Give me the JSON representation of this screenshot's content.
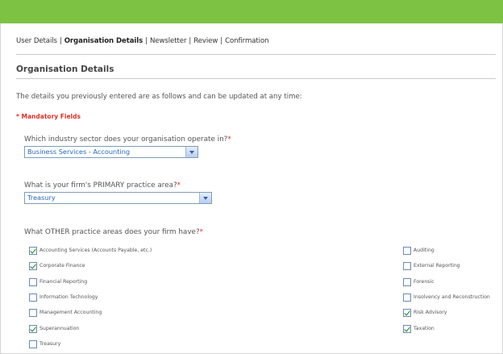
{
  "nav": {
    "steps": [
      {
        "label": "User Details",
        "current": false
      },
      {
        "label": "Organisation Details",
        "current": true
      },
      {
        "label": "Newsletter",
        "current": false
      },
      {
        "label": "Review",
        "current": false
      },
      {
        "label": "Confirmation",
        "current": false
      }
    ],
    "separator": "|"
  },
  "section": {
    "title": "Organisation Details",
    "intro": "The details you previously entered are as follows and can be updated at any time:",
    "mandatory_note": "* Mandatory Fields"
  },
  "form": {
    "required_mark": "*",
    "industry": {
      "question": "Which industry sector does your organisation operate in?",
      "selected": "Business Services - Accounting"
    },
    "primary": {
      "question": "What is your firm's PRIMARY practice area?",
      "selected": "Treasury"
    },
    "other": {
      "question": "What OTHER practice areas does your firm have?",
      "left": [
        {
          "label": "Accounting Services (Accounts Payable, etc.)",
          "checked": true
        },
        {
          "label": "Corporate Finance",
          "checked": true
        },
        {
          "label": "Financial Reporting",
          "checked": false
        },
        {
          "label": "Information Technology",
          "checked": false
        },
        {
          "label": "Management Accounting",
          "checked": false
        },
        {
          "label": "Superannuation",
          "checked": true
        },
        {
          "label": "Treasury",
          "checked": false
        }
      ],
      "right": [
        {
          "label": "Auditing",
          "checked": false
        },
        {
          "label": "External Reporting",
          "checked": false
        },
        {
          "label": "Forensic",
          "checked": false
        },
        {
          "label": "Insolvency and Reconstruction",
          "checked": false
        },
        {
          "label": "Risk Advisory",
          "checked": true
        },
        {
          "label": "Taxation",
          "checked": true
        }
      ]
    }
  },
  "colors": {
    "header_bar": "#7dc243",
    "required": "#d93025",
    "select_text": "#2a6ab3"
  }
}
